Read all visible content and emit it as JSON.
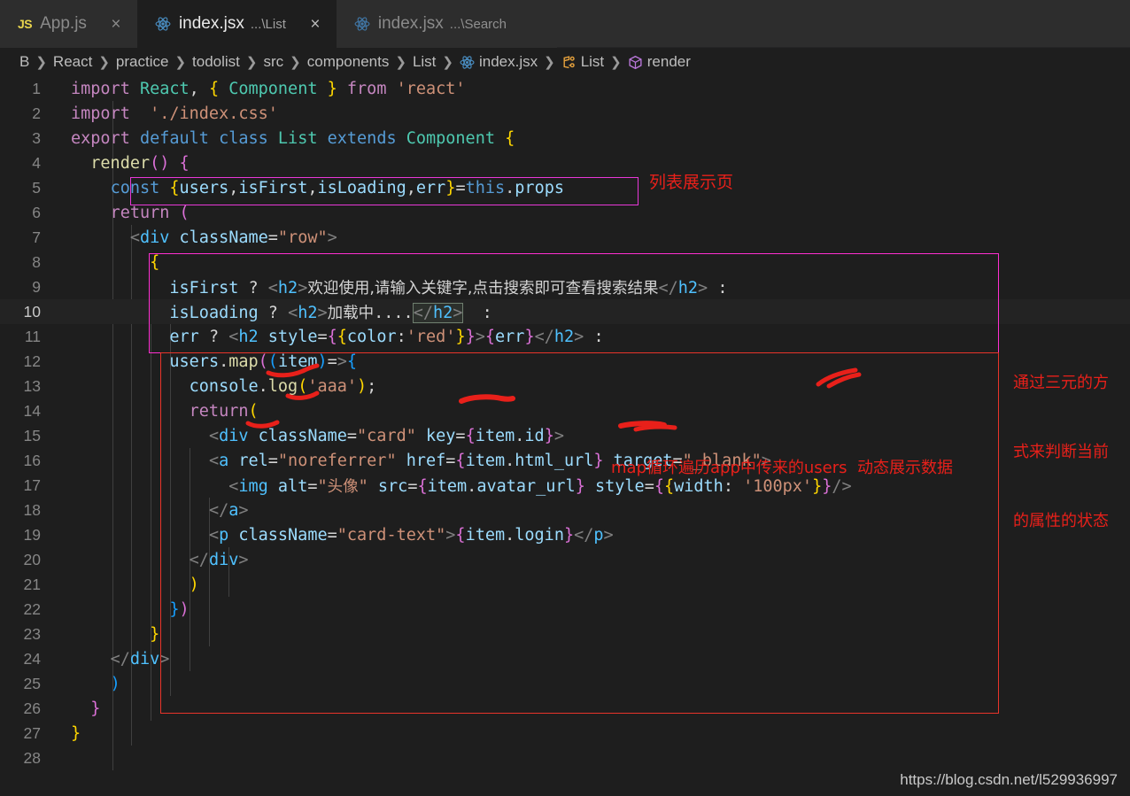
{
  "window": {
    "background": "#1e1e1e",
    "tabbar_background": "#2d2d2d"
  },
  "tabs": [
    {
      "icon": "js-icon",
      "icon_label": "JS",
      "title": "App.js",
      "sub": "",
      "active": false,
      "close": "×"
    },
    {
      "icon": "react-icon",
      "icon_label": "",
      "title": "index.jsx",
      "sub": "...\\List",
      "active": true,
      "close": "×"
    },
    {
      "icon": "react-icon",
      "icon_label": "",
      "title": "index.jsx",
      "sub": "...\\Search",
      "active": false,
      "close": "×"
    }
  ],
  "breadcrumb": {
    "items": [
      {
        "label": "B",
        "icon": ""
      },
      {
        "label": "React",
        "icon": ""
      },
      {
        "label": "practice",
        "icon": ""
      },
      {
        "label": "todolist",
        "icon": ""
      },
      {
        "label": "src",
        "icon": ""
      },
      {
        "label": "components",
        "icon": ""
      },
      {
        "label": "List",
        "icon": ""
      },
      {
        "label": "index.jsx",
        "icon": "react-file-icon"
      },
      {
        "label": "List",
        "icon": "class-symbol-icon"
      },
      {
        "label": "render",
        "icon": "method-symbol-icon"
      }
    ],
    "separator": "❯"
  },
  "editor": {
    "current_line": 10,
    "line_numbers": [
      1,
      2,
      3,
      4,
      5,
      6,
      7,
      8,
      9,
      10,
      11,
      12,
      13,
      14,
      15,
      16,
      17,
      18,
      19,
      20,
      21,
      22,
      23,
      24,
      25,
      26,
      27,
      28
    ],
    "lines": [
      {
        "n": 1,
        "text": "import React, { Component } from 'react'"
      },
      {
        "n": 2,
        "text": "import  './index.css'"
      },
      {
        "n": 3,
        "text": "export default class List extends Component {"
      },
      {
        "n": 4,
        "text": "  render() {"
      },
      {
        "n": 5,
        "text": "    const {users,isFirst,isLoading,err}=this.props"
      },
      {
        "n": 6,
        "text": "    return ("
      },
      {
        "n": 7,
        "text": "      <div className=\"row\">"
      },
      {
        "n": 8,
        "text": "        {"
      },
      {
        "n": 9,
        "text": "          isFirst ? <h2>欢迎使用,请输入关键字,点击搜索即可查看搜索结果</h2> :"
      },
      {
        "n": 10,
        "text": "          isLoading ? <h2>加载中....</h2> :"
      },
      {
        "n": 11,
        "text": "          err ? <h2 style={{color:'red'}}>{err}</h2> :"
      },
      {
        "n": 12,
        "text": "          users.map((item)=>{"
      },
      {
        "n": 13,
        "text": "            console.log('aaa');"
      },
      {
        "n": 14,
        "text": "            return("
      },
      {
        "n": 15,
        "text": "              <div className=\"card\" key={item.id}>"
      },
      {
        "n": 16,
        "text": "              <a rel=\"noreferrer\" href={item.html_url} target=\"_blank\">"
      },
      {
        "n": 17,
        "text": "                <img alt=\"头像\" src={item.avatar_url} style={{width: '100px'}}/>"
      },
      {
        "n": 18,
        "text": "              </a>"
      },
      {
        "n": 19,
        "text": "              <p className=\"card-text\">{item.login}</p>"
      },
      {
        "n": 20,
        "text": "            </div>"
      },
      {
        "n": 21,
        "text": "            )"
      },
      {
        "n": 22,
        "text": "          })"
      },
      {
        "n": 23,
        "text": "        }"
      },
      {
        "n": 24,
        "text": "    </div>"
      },
      {
        "n": 25,
        "text": "    )"
      },
      {
        "n": 26,
        "text": "  }"
      },
      {
        "n": 27,
        "text": "}"
      },
      {
        "n": 28,
        "text": ""
      }
    ]
  },
  "annotations": {
    "color": "#e8201a",
    "top_label": "列表展示页",
    "right_label_lines": [
      "通过三元的方",
      "式来判断当前",
      "的属性的状态"
    ],
    "map_label": "map循环遍历app中传来的users  动态展示数据",
    "boxes": [
      {
        "name": "const-destructure-box",
        "color": "#e838d8"
      },
      {
        "name": "ternary-block-box",
        "color": "#ff2fd0"
      },
      {
        "name": "map-block-box",
        "color": "#e8342a"
      }
    ]
  },
  "watermark": "https://blog.csdn.net/l529936997"
}
